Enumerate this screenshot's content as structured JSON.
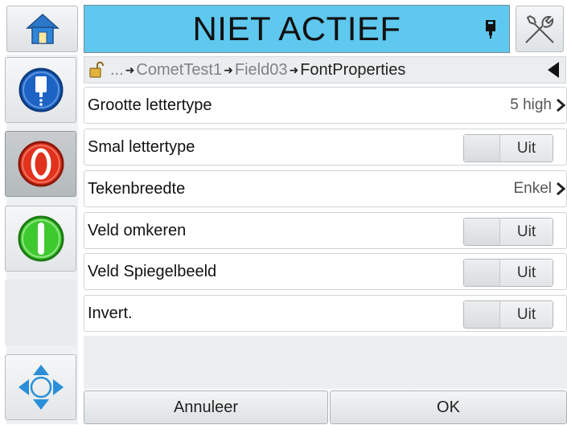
{
  "header": {
    "status_text": "NIET ACTIEF"
  },
  "icons": {
    "home": "home-icon",
    "ink": "ink-cartridge-icon",
    "tools": "tools-icon",
    "jet": "jet-status-icon",
    "stop": "stop-icon",
    "start": "start-icon",
    "nav": "navigation-arrows-icon",
    "lock": "unlocked-padlock-icon",
    "back": "back-arrow-icon",
    "chevron": "chevron-right-icon"
  },
  "breadcrumb": {
    "ellipsis": "...",
    "items": [
      "CometTest1",
      "Field03",
      "FontProperties"
    ]
  },
  "rows": [
    {
      "label": "Grootte lettertype",
      "value": "5 high"
    },
    {
      "label": "Smal lettertype",
      "toggle": "Uit"
    },
    {
      "label": "Tekenbreedte",
      "value": "Enkel"
    },
    {
      "label": "Veld omkeren",
      "toggle": "Uit"
    },
    {
      "label": "Veld Spiegelbeeld",
      "toggle": "Uit"
    },
    {
      "label": "Invert.",
      "toggle": "Uit"
    }
  ],
  "buttons": {
    "cancel": "Annuleer",
    "ok": "OK"
  },
  "colors": {
    "status_bar": "#5fc8ee",
    "stop_red": "#e0321c",
    "start_green": "#3ec92f",
    "jet_blue": "#1d63c4"
  }
}
